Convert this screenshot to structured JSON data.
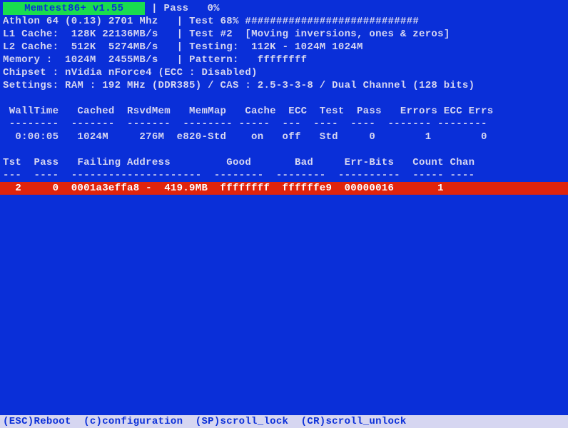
{
  "title": "   Memtest86+ v1.55   ",
  "header": {
    "pass_label": "Pass",
    "pass_pct": "0%",
    "cpu": "Athlon 64 (0.13) 2701 Mhz",
    "test_label": "Test",
    "test_pct": "68%",
    "test_bar": "############################",
    "l1": "L1 Cache:  128K 22136MB/s",
    "test_desc": "Test #2  [Moving inversions, ones & zeros]",
    "l2": "L2 Cache:  512K  5274MB/s",
    "testing": "Testing:  112K - 1024M 1024M",
    "mem": "Memory :  1024M  2455MB/s",
    "pattern": "Pattern:   ffffffff",
    "chipset": "Chipset : nVidia nForce4 (ECC : Disabled)",
    "settings": "Settings: RAM : 192 MHz (DDR385) / CAS : 2.5-3-3-8 / Dual Channel (128 bits)"
  },
  "status_cols": {
    "headers": [
      "WallTime",
      "Cached",
      "RsvdMem",
      "MemMap",
      "Cache",
      "ECC",
      "Test",
      "Pass",
      "Errors",
      "ECC Errs"
    ],
    "header_line": " WallTime   Cached  RsvdMem   MemMap   Cache  ECC  Test  Pass   Errors ECC Errs",
    "divider": " --------  -------  -------  -------- -----  ---  ----  ----  ------- --------",
    "row": "  0:00:05   1024M     276M  e820-Std    on   off   Std     0        1        0",
    "values": {
      "WallTime": "0:00:05",
      "Cached": "1024M",
      "RsvdMem": "276M",
      "MemMap": "e820-Std",
      "Cache": "on",
      "ECC": "off",
      "Test": "Std",
      "Pass": "0",
      "Errors": "1",
      "ECC Errs": "0"
    }
  },
  "err_cols": {
    "headers": [
      "Tst",
      "Pass",
      "Failing Address",
      "Good",
      "Bad",
      "Err-Bits",
      "Count",
      "Chan"
    ],
    "header_line": "Tst  Pass   Failing Address         Good       Bad     Err-Bits   Count Chan",
    "divider": "---  ----  ---------------------  --------  --------  ----------  ----- ----",
    "row": "  2     0  0001a3effa8 -  419.9MB  ffffffff  ffffffe9  00000016       1      ",
    "values": {
      "Tst": "2",
      "Pass": "0",
      "Failing Address": "0001a3effa8 -  419.9MB",
      "Good": "ffffffff",
      "Bad": "ffffffe9",
      "Err-Bits": "00000016",
      "Count": "1",
      "Chan": ""
    }
  },
  "footer": {
    "text": "(ESC)Reboot  (c)configuration  (SP)scroll_lock  (CR)scroll_unlock",
    "keys": [
      {
        "key": "ESC",
        "action": "Reboot"
      },
      {
        "key": "c",
        "action": "configuration"
      },
      {
        "key": "SP",
        "action": "scroll_lock"
      },
      {
        "key": "CR",
        "action": "scroll_unlock"
      }
    ]
  }
}
